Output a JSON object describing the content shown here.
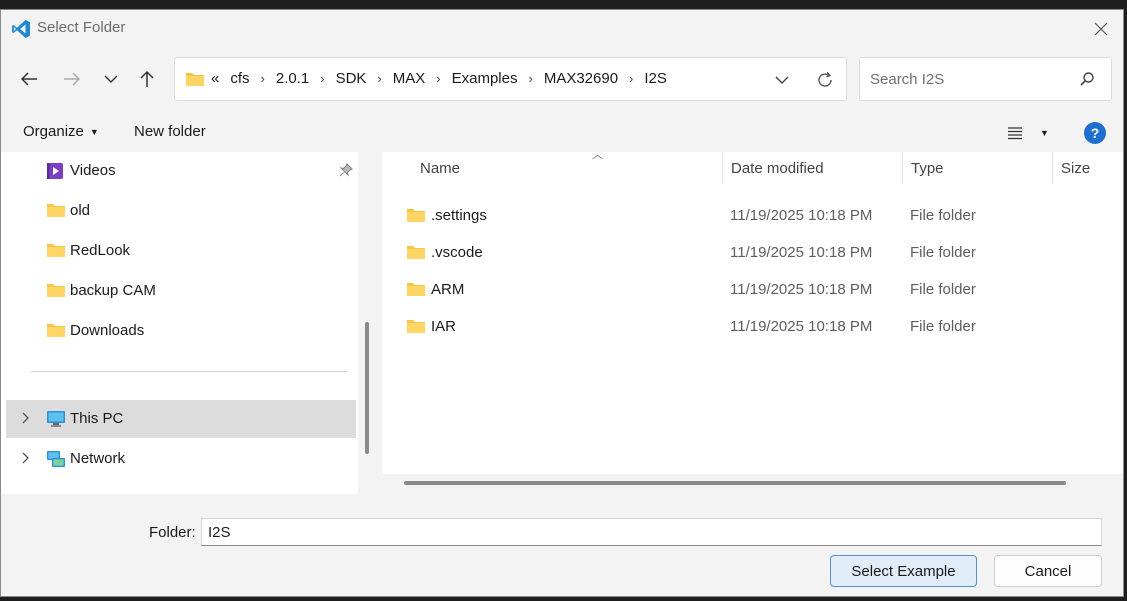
{
  "window": {
    "title": "Select Folder"
  },
  "address": {
    "overflow": "«",
    "crumbs": [
      "cfs",
      "2.0.1",
      "SDK",
      "MAX",
      "Examples",
      "MAX32690",
      "I2S"
    ]
  },
  "search": {
    "placeholder": "Search I2S"
  },
  "toolbar": {
    "organize": "Organize",
    "new_folder": "New folder",
    "help": "?"
  },
  "navpane": {
    "items": [
      {
        "label": "Videos",
        "icon": "videos-icon",
        "pinned": true
      },
      {
        "label": "old",
        "icon": "folder-icon"
      },
      {
        "label": "RedLook",
        "icon": "folder-icon"
      },
      {
        "label": "backup CAM",
        "icon": "folder-icon"
      },
      {
        "label": "Downloads",
        "icon": "folder-icon"
      },
      {
        "label": "This PC",
        "icon": "computer-icon",
        "selected": true
      },
      {
        "label": "Network",
        "icon": "network-icon"
      }
    ]
  },
  "columns": {
    "name": "Name",
    "date": "Date modified",
    "type": "Type",
    "size": "Size"
  },
  "files": [
    {
      "name": ".settings",
      "date": "11/19/2025 10:18 PM",
      "type": "File folder"
    },
    {
      "name": ".vscode",
      "date": "11/19/2025 10:18 PM",
      "type": "File folder"
    },
    {
      "name": "ARM",
      "date": "11/19/2025 10:18 PM",
      "type": "File folder"
    },
    {
      "name": "IAR",
      "date": "11/19/2025 10:18 PM",
      "type": "File folder"
    }
  ],
  "footer": {
    "folder_label": "Folder:",
    "folder_value": "I2S",
    "select_button": "Select Example",
    "cancel_button": "Cancel"
  },
  "colors": {
    "accent": "#1f6fd1",
    "folder": "#f4c542",
    "selected_bg": "#dcdcdc"
  }
}
